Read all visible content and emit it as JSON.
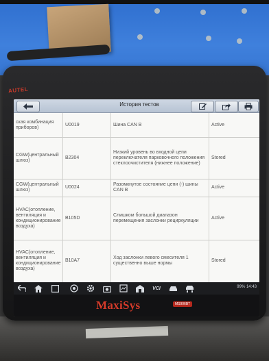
{
  "device": {
    "logo_text": "AUTEL",
    "product_name": "MaxiSys",
    "product_badge": "MS906BT"
  },
  "header": {
    "title": "История тестов",
    "back_icon": "arrow-left-icon",
    "buttons": [
      {
        "icon": "edit-icon"
      },
      {
        "icon": "share-icon"
      },
      {
        "icon": "print-icon"
      }
    ]
  },
  "table": {
    "rows": [
      {
        "system": "ская комбинация приборов)",
        "code": "U0019",
        "description": "Шина CAN B",
        "status": "Active"
      },
      {
        "system": "CGW(центральный шлюз)",
        "code": "B2304",
        "description": "Низкий уровень во входной цепи переключателя парковочного положения стеклоочистителя (нижнее положение)",
        "status": "Stored"
      },
      {
        "system": "CGW(центральный шлюз)",
        "code": "U0024",
        "description": "Разомкнутое состояние цепи (-) шины CAN B",
        "status": "Active"
      },
      {
        "system": "HVAC(отопление, вентиляция и кондиционирование воздуха)",
        "code": "B105D",
        "description": "Слишком большой диапазон перемещения заслонки рециркуляции",
        "status": "Active"
      },
      {
        "system": "HVAC(отопление, вентиляция и кондиционирование воздуха)",
        "code": "B10A7",
        "description": "Ход заслонки левого смесителя 1 существенно выше нормы",
        "status": "Stored"
      }
    ]
  },
  "navbar": {
    "status_text": "99% 14:43",
    "vci_label": "VCI"
  },
  "colors": {
    "header_bg": "#c3cdda",
    "brand_red": "#d73b2a",
    "nav_bg": "#1c1d20"
  }
}
